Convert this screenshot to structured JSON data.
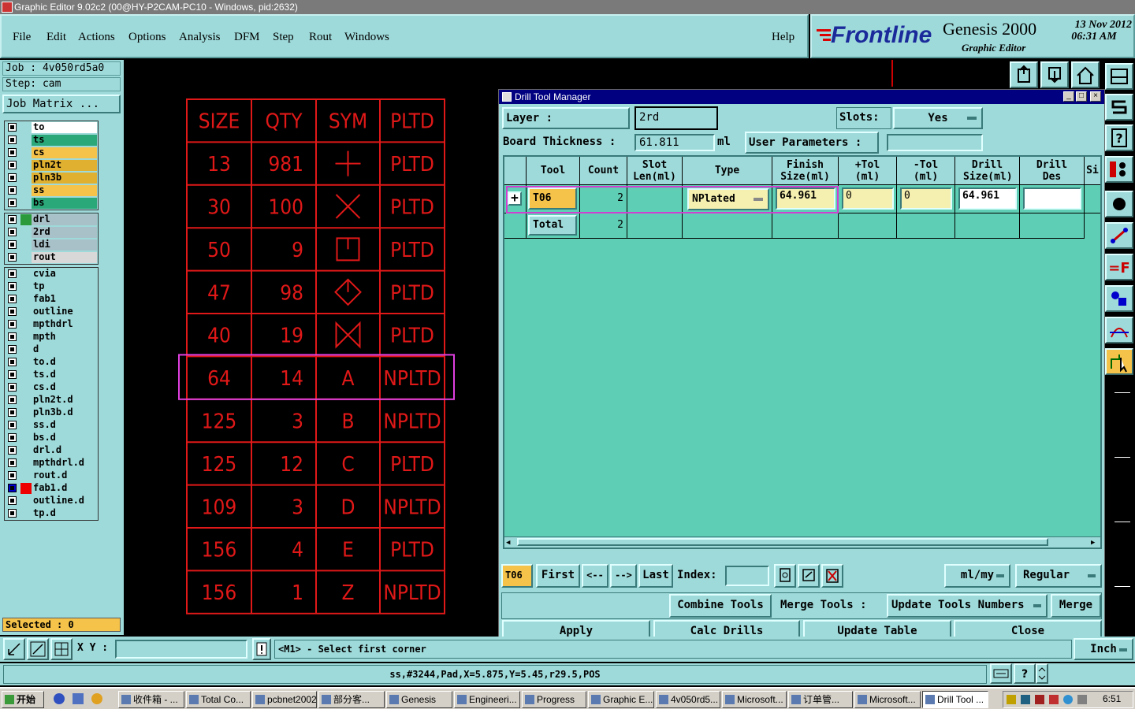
{
  "window": {
    "title": "Graphic Editor 9.02c2 (00@HY-P2CAM-PC10 - Windows, pid:2632)"
  },
  "menu": [
    "File",
    "Edit",
    "Actions",
    "Options",
    "Analysis",
    "DFM",
    "Step",
    "Rout",
    "Windows"
  ],
  "help": "Help",
  "brand": {
    "logo": "Frontline",
    "product": "Genesis 2000",
    "subtitle": "Graphic Editor",
    "date": "13 Nov 2012",
    "time": "06:31 AM"
  },
  "job": {
    "job_label": "Job : 4v050rd5a0",
    "step_label": "Step: cam",
    "matrix_button": "Job Matrix ..."
  },
  "layers": {
    "group1": [
      {
        "name": "to",
        "color": "#ffffff"
      },
      {
        "name": "ts",
        "color": "#2aa87a"
      },
      {
        "name": "cs",
        "color": "#f5c34a"
      },
      {
        "name": "pln2t",
        "color": "#e0b030"
      },
      {
        "name": "pln3b",
        "color": "#e0b030"
      },
      {
        "name": "ss",
        "color": "#f5c34a"
      },
      {
        "name": "bs",
        "color": "#2aa87a"
      }
    ],
    "group2": [
      {
        "name": "drl",
        "color": "#a8c0c8"
      },
      {
        "name": "2rd",
        "color": "#a8c0c8"
      },
      {
        "name": "ldi",
        "color": "#a8c0c8"
      },
      {
        "name": "rout",
        "color": "#d8d8d8"
      }
    ],
    "group3": [
      {
        "name": "cvia"
      },
      {
        "name": "tp"
      },
      {
        "name": "fab1"
      },
      {
        "name": "outline"
      },
      {
        "name": "mpthdrl"
      },
      {
        "name": "mpth"
      },
      {
        "name": "d"
      },
      {
        "name": "to.d"
      },
      {
        "name": "ts.d"
      },
      {
        "name": "cs.d"
      },
      {
        "name": "pln2t.d"
      },
      {
        "name": "pln3b.d"
      },
      {
        "name": "ss.d"
      },
      {
        "name": "bs.d"
      },
      {
        "name": "drl.d"
      },
      {
        "name": "mpthdrl.d"
      },
      {
        "name": "rout.d"
      },
      {
        "name": "fab1.d"
      },
      {
        "name": "outline.d"
      },
      {
        "name": "tp.d"
      }
    ]
  },
  "selected": "Selected : 0",
  "drill_table": {
    "headers": [
      "SIZE",
      "QTY",
      "SYM",
      "PLTD"
    ],
    "rows": [
      [
        "13",
        "981",
        "plus",
        "PLTD"
      ],
      [
        "30",
        "100",
        "cross",
        "PLTD"
      ],
      [
        "50",
        "9",
        "square",
        "PLTD"
      ],
      [
        "47",
        "98",
        "diamond",
        "PLTD"
      ],
      [
        "40",
        "19",
        "bowtie",
        "PLTD"
      ],
      [
        "64",
        "14",
        "A",
        "NPLTD"
      ],
      [
        "125",
        "3",
        "B",
        "NPLTD"
      ],
      [
        "125",
        "12",
        "C",
        "PLTD"
      ],
      [
        "109",
        "3",
        "D",
        "NPLTD"
      ],
      [
        "156",
        "4",
        "E",
        "PLTD"
      ],
      [
        "156",
        "1",
        "Z",
        "NPLTD"
      ]
    ]
  },
  "dtm": {
    "title": "Drill Tool Manager",
    "layer_label": "Layer          :",
    "layer_value": "2rd",
    "slots_label": "Slots:",
    "slots_value": "Yes",
    "thickness_label": "Board Thickness :",
    "thickness_value": "61.811",
    "thickness_unit": "ml",
    "user_params_label": "User Parameters :",
    "columns": [
      "Tool",
      "Count",
      "Slot Len(ml)",
      "Type",
      "Finish Size(ml)",
      "+Tol (ml)",
      "-Tol (ml)",
      "Drill Size(ml)",
      "Drill Des",
      "Si"
    ],
    "row": {
      "tool": "T06",
      "count": "2",
      "type": "NPlated",
      "finish": "64.961",
      "ptol": "0",
      "mtol": "0",
      "drill": "64.961"
    },
    "total_label": "Total",
    "total_count": "2",
    "nav": {
      "current": "T06",
      "first": "First",
      "prev": "<--",
      "next": "-->",
      "last": "Last",
      "index": "Index:",
      "units": "ml/my",
      "mode": "Regular"
    },
    "actions": {
      "combine": "Combine Tools",
      "merge_label": "Merge Tools :",
      "update_numbers": "Update Tools Numbers",
      "merge": "Merge"
    },
    "buttons": {
      "apply": "Apply",
      "calc": "Calc Drills",
      "update": "Update Table",
      "close": "Close"
    }
  },
  "cmd": {
    "xy": "X Y :",
    "prompt": "<M1> - Select first corner",
    "units": "Inch"
  },
  "status": "ss,#3244,Pad,X=5.875,Y=5.45,r29.5,POS",
  "taskbar": {
    "start": "开始",
    "clock": "6:51",
    "items": [
      "收件箱 - ...",
      "Total Co...",
      "pcbnet2002",
      "部分客...",
      "Genesis",
      "Engineeri...",
      "Progress",
      "Graphic E...",
      "4v050rd5...",
      "Microsoft...",
      "订单管...",
      "Microsoft...",
      "Drill Tool ..."
    ]
  }
}
